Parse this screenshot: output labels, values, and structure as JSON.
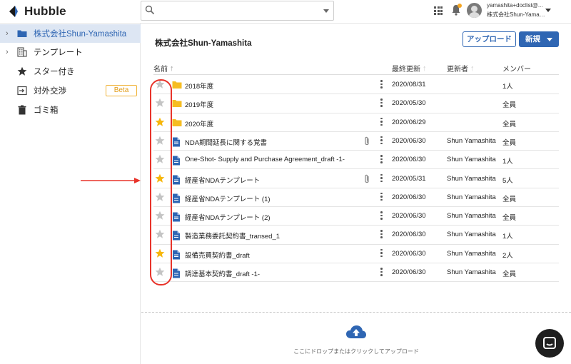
{
  "app": {
    "name": "Hubble"
  },
  "header": {
    "search": {
      "value": "",
      "placeholder": ""
    },
    "user": {
      "email": "yamashita+doclist@...",
      "org": "株式会社Shun-Yamashita"
    }
  },
  "sidebar": {
    "items": [
      {
        "label": "株式会社Shun-Yamashita",
        "icon": "folder-icon",
        "active": true
      },
      {
        "label": "テンプレート",
        "icon": "building-icon"
      },
      {
        "label": "スター付き",
        "icon": "star-icon"
      },
      {
        "label": "対外交渉",
        "icon": "external-icon",
        "badge": "Beta"
      },
      {
        "label": "ゴミ箱",
        "icon": "trash-icon"
      }
    ]
  },
  "main": {
    "title": "株式会社Shun-Yamashita",
    "upload_label": "アップロード",
    "new_label": "新規",
    "columns": {
      "name": "名前",
      "updated": "最終更新",
      "updater": "更新者",
      "members": "メンバー"
    },
    "rows": [
      {
        "starred": false,
        "type": "folder",
        "name": "2018年度",
        "clip": false,
        "date": "2020/08/31",
        "updater": "",
        "members": "1人"
      },
      {
        "starred": false,
        "type": "folder",
        "name": "2019年度",
        "clip": false,
        "date": "2020/05/30",
        "updater": "",
        "members": "全員"
      },
      {
        "starred": true,
        "type": "folder",
        "name": "2020年度",
        "clip": false,
        "date": "2020/06/29",
        "updater": "",
        "members": "全員"
      },
      {
        "starred": false,
        "type": "doc",
        "name": "NDA期間延長に関する覚書",
        "clip": true,
        "date": "2020/06/30",
        "updater": "Shun Yamashita",
        "members": "全員"
      },
      {
        "starred": false,
        "type": "doc",
        "name": "One-Shot- Supply and Purchase Agreement_draft -1-",
        "clip": false,
        "date": "2020/06/30",
        "updater": "Shun Yamashita",
        "members": "1人"
      },
      {
        "starred": true,
        "type": "doc",
        "name": "経産省NDAテンプレート",
        "clip": true,
        "date": "2020/05/31",
        "updater": "Shun Yamashita",
        "members": "5人"
      },
      {
        "starred": false,
        "type": "doc",
        "name": "経産省NDAテンプレート (1)",
        "clip": false,
        "date": "2020/06/30",
        "updater": "Shun Yamashita",
        "members": "全員"
      },
      {
        "starred": false,
        "type": "doc",
        "name": "経産省NDAテンプレート (2)",
        "clip": false,
        "date": "2020/06/30",
        "updater": "Shun Yamashita",
        "members": "全員"
      },
      {
        "starred": false,
        "type": "doc",
        "name": "製造業務委託契約書_transed_1",
        "clip": false,
        "date": "2020/06/30",
        "updater": "Shun Yamashita",
        "members": "1人"
      },
      {
        "starred": true,
        "type": "doc",
        "name": "設備売買契約書_draft",
        "clip": false,
        "date": "2020/06/30",
        "updater": "Shun Yamashita",
        "members": "2人"
      },
      {
        "starred": false,
        "type": "doc",
        "name": "調達基本契約書_draft -1-",
        "clip": false,
        "date": "2020/06/30",
        "updater": "Shun Yamashita",
        "members": "全員"
      }
    ],
    "dropzone_text": "ここにドロップまたはクリックしてアップロード"
  },
  "colors": {
    "accent": "#2f66b3",
    "star_on": "#f6b60b",
    "star_off": "#c4c4c4",
    "folder": "#f6bd22",
    "doc": "#2f66b3",
    "annotation": "#e8332a",
    "beta": "#e29b14"
  }
}
